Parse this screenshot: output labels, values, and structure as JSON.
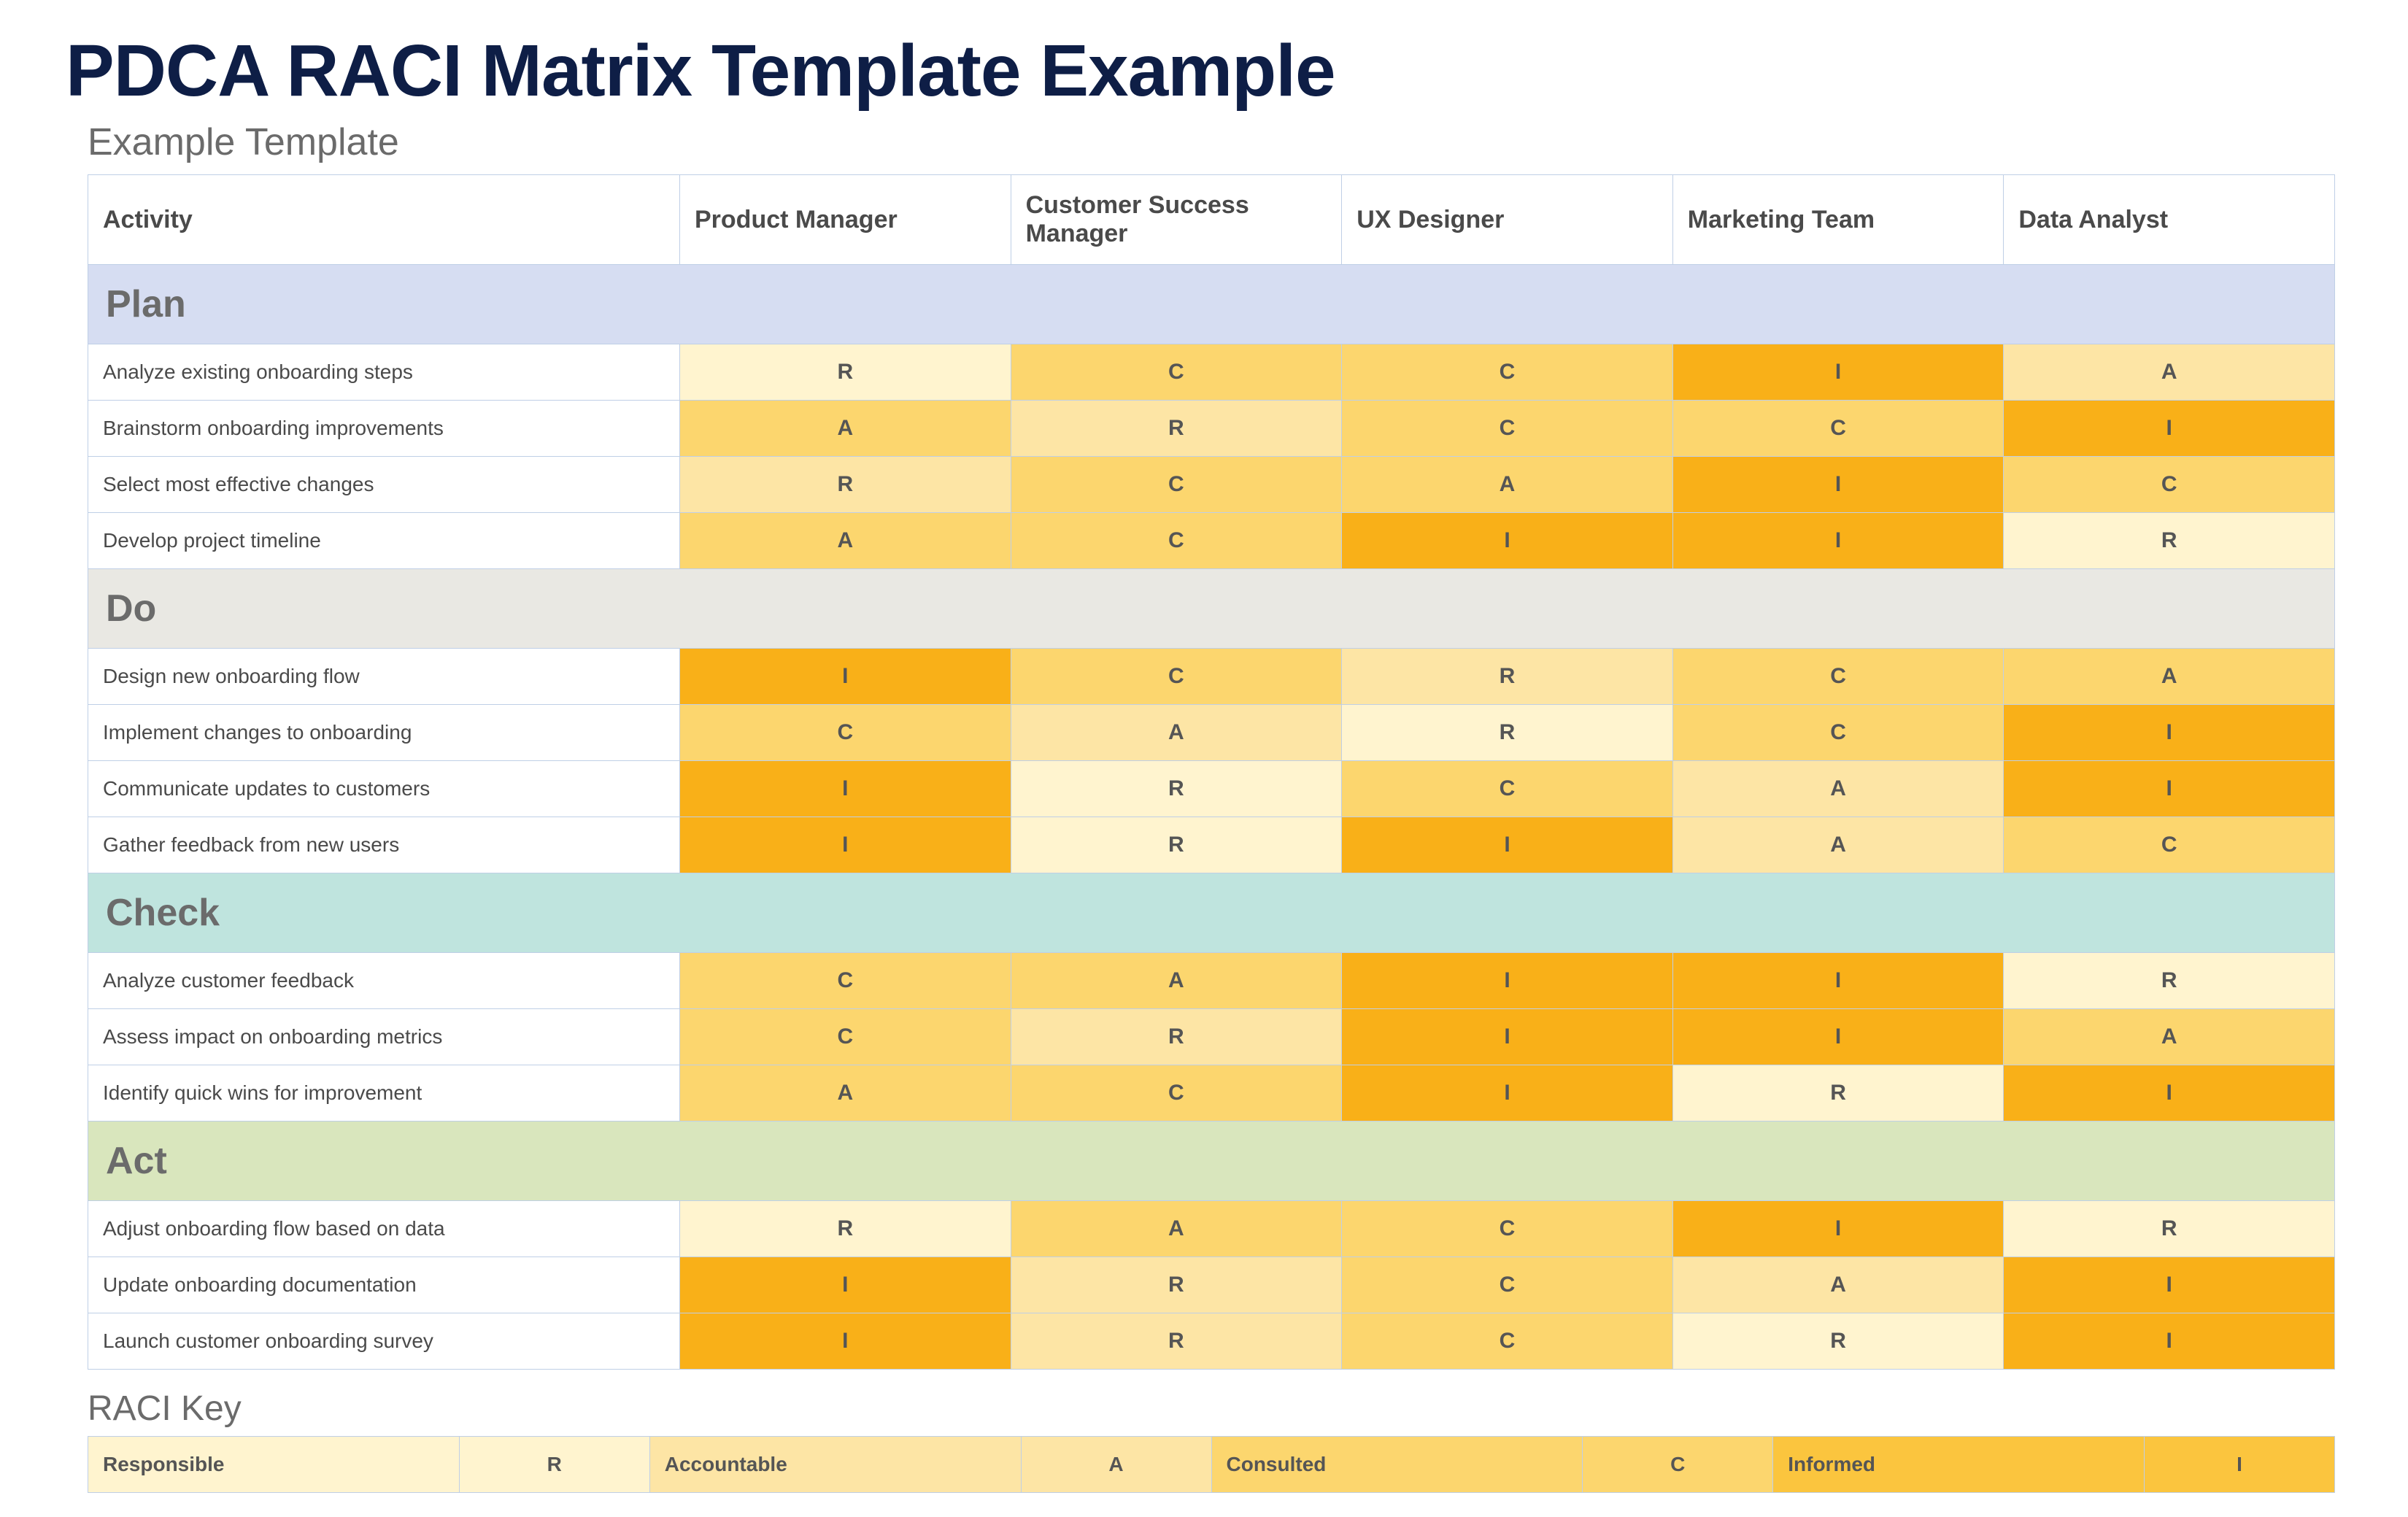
{
  "title": "PDCA RACI Matrix Template Example",
  "subtitle": "Example Template",
  "columns": [
    "Activity",
    "Product Manager",
    "Customer Success Manager",
    "UX Designer",
    "Marketing Team",
    "Data Analyst"
  ],
  "sections": [
    {
      "name": "Plan",
      "bg": "bg-plan",
      "rows": [
        {
          "activity": "Analyze existing onboarding steps",
          "cells": [
            [
              "R",
              1
            ],
            [
              "C",
              3
            ],
            [
              "C",
              3
            ],
            [
              "I",
              5
            ],
            [
              "A",
              2
            ]
          ]
        },
        {
          "activity": "Brainstorm onboarding improvements",
          "cells": [
            [
              "A",
              3
            ],
            [
              "R",
              2
            ],
            [
              "C",
              3
            ],
            [
              "C",
              3
            ],
            [
              "I",
              5
            ]
          ]
        },
        {
          "activity": "Select most effective changes",
          "cells": [
            [
              "R",
              2
            ],
            [
              "C",
              3
            ],
            [
              "A",
              3
            ],
            [
              "I",
              5
            ],
            [
              "C",
              3
            ]
          ]
        },
        {
          "activity": "Develop project timeline",
          "cells": [
            [
              "A",
              3
            ],
            [
              "C",
              3
            ],
            [
              "I",
              5
            ],
            [
              "I",
              5
            ],
            [
              "R",
              1
            ]
          ]
        }
      ]
    },
    {
      "name": "Do",
      "bg": "bg-do",
      "rows": [
        {
          "activity": "Design new onboarding flow",
          "cells": [
            [
              "I",
              5
            ],
            [
              "C",
              3
            ],
            [
              "R",
              2
            ],
            [
              "C",
              3
            ],
            [
              "A",
              3
            ]
          ]
        },
        {
          "activity": "Implement changes to onboarding",
          "cells": [
            [
              "C",
              3
            ],
            [
              "A",
              2
            ],
            [
              "R",
              1
            ],
            [
              "C",
              3
            ],
            [
              "I",
              5
            ]
          ]
        },
        {
          "activity": "Communicate updates to customers",
          "cells": [
            [
              "I",
              5
            ],
            [
              "R",
              1
            ],
            [
              "C",
              3
            ],
            [
              "A",
              2
            ],
            [
              "I",
              5
            ]
          ]
        },
        {
          "activity": "Gather feedback from new users",
          "cells": [
            [
              "I",
              5
            ],
            [
              "R",
              1
            ],
            [
              "I",
              5
            ],
            [
              "A",
              2
            ],
            [
              "C",
              3
            ]
          ]
        }
      ]
    },
    {
      "name": "Check",
      "bg": "bg-check",
      "rows": [
        {
          "activity": "Analyze customer feedback",
          "cells": [
            [
              "C",
              3
            ],
            [
              "A",
              3
            ],
            [
              "I",
              5
            ],
            [
              "I",
              5
            ],
            [
              "R",
              1
            ]
          ]
        },
        {
          "activity": "Assess impact on onboarding metrics",
          "cells": [
            [
              "C",
              3
            ],
            [
              "R",
              2
            ],
            [
              "I",
              5
            ],
            [
              "I",
              5
            ],
            [
              "A",
              3
            ]
          ]
        },
        {
          "activity": "Identify quick wins for improvement",
          "cells": [
            [
              "A",
              3
            ],
            [
              "C",
              3
            ],
            [
              "I",
              5
            ],
            [
              "R",
              1
            ],
            [
              "I",
              5
            ]
          ]
        }
      ]
    },
    {
      "name": "Act",
      "bg": "bg-act",
      "rows": [
        {
          "activity": "Adjust onboarding flow based on data",
          "cells": [
            [
              "R",
              1
            ],
            [
              "A",
              3
            ],
            [
              "C",
              3
            ],
            [
              "I",
              5
            ],
            [
              "R",
              1
            ]
          ]
        },
        {
          "activity": "Update onboarding documentation",
          "cells": [
            [
              "I",
              5
            ],
            [
              "R",
              2
            ],
            [
              "C",
              3
            ],
            [
              "A",
              2
            ],
            [
              "I",
              5
            ]
          ]
        },
        {
          "activity": "Launch customer onboarding survey",
          "cells": [
            [
              "I",
              5
            ],
            [
              "R",
              2
            ],
            [
              "C",
              3
            ],
            [
              "R",
              1
            ],
            [
              "I",
              5
            ]
          ]
        }
      ]
    }
  ],
  "key_title": "RACI Key",
  "key": [
    {
      "label": "Responsible",
      "letter": "R",
      "shade": 1
    },
    {
      "label": "Accountable",
      "letter": "A",
      "shade": 2
    },
    {
      "label": "Consulted",
      "letter": "C",
      "shade": 3
    },
    {
      "label": "Informed",
      "letter": "I",
      "shade": 4
    }
  ]
}
